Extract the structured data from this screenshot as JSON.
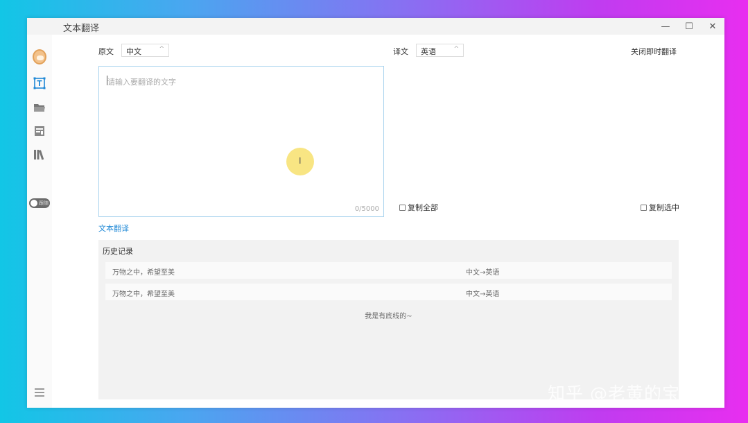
{
  "window": {
    "title": "文本翻译",
    "min_glyph": "—",
    "max_glyph": "☐",
    "close_glyph": "✕"
  },
  "sidebar": {
    "toggle_label": "跟随"
  },
  "source": {
    "label": "原文",
    "language": "中文",
    "placeholder": "请输入要翻译的文字",
    "count": "0/5000",
    "link": "文本翻译"
  },
  "target": {
    "label": "译文",
    "language": "英语",
    "close_instant": "关闭即时翻译",
    "copy_all": "复制全部",
    "copy_selected": "复制选中"
  },
  "history": {
    "title": "历史记录",
    "rows": [
      {
        "text": "万物之中，希望至美",
        "direction": "中文→英语"
      },
      {
        "text": "万物之中，希望至美",
        "direction": "中文→英语"
      }
    ],
    "end_text": "我是有底线的~"
  },
  "watermark": "知乎 @老黄的宝库",
  "colors": {
    "accent": "#1e88d6",
    "input_border": "#a9d3ee",
    "history_bg": "#f2f2f2"
  }
}
